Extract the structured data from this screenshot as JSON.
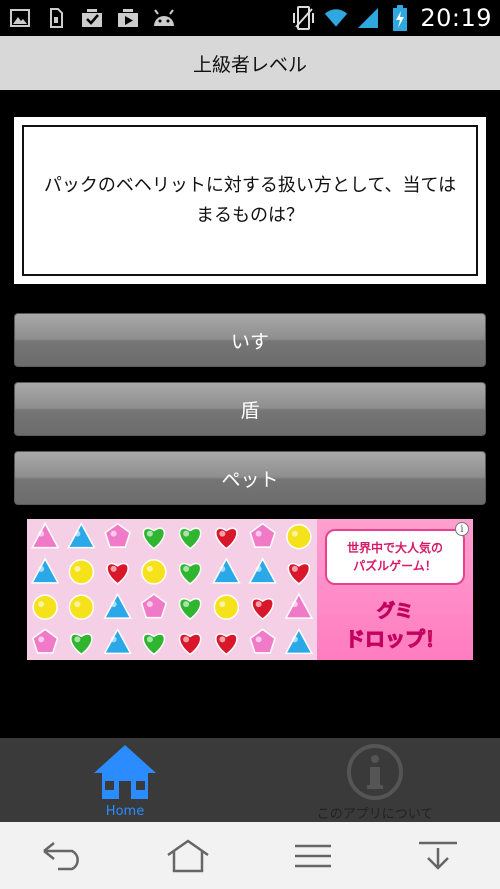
{
  "status_bar": {
    "time": "20:19",
    "left_icons": [
      "image-icon",
      "sim-icon",
      "download-icon",
      "play-store-icon",
      "android-icon"
    ],
    "right_icons": [
      "vibrate-icon",
      "wifi-icon",
      "signal-icon",
      "battery-charging-icon"
    ]
  },
  "header": {
    "title": "上級者レベル"
  },
  "question": {
    "text": "パックのベヘリットに対する扱い方として、当てはまるものは？"
  },
  "answers": [
    {
      "label": "いす"
    },
    {
      "label": "盾"
    },
    {
      "label": "ペット"
    }
  ],
  "ad": {
    "line1": "世界中で大人気の",
    "line2": "パズルゲーム！",
    "logo_line1": "グミ",
    "logo_line2": "ドロップ！",
    "info": "i",
    "candy_colors": {
      "pink": "#f07ac8",
      "blue": "#2aa8e8",
      "yellow": "#f6e21a",
      "green": "#2fb52f",
      "red": "#d8182a"
    }
  },
  "tabs": [
    {
      "label": "Home",
      "icon": "home-icon",
      "active": true
    },
    {
      "label": "このアプリについて",
      "icon": "info-icon",
      "active": false
    }
  ],
  "nav_bar": {
    "icons": [
      "back-icon",
      "home-nav-icon",
      "menu-icon",
      "hide-keyboard-icon"
    ]
  },
  "colors": {
    "accent": "#2b8cff",
    "title_bar": "#d8d8d8",
    "tab_bar": "#3a3a3a"
  }
}
